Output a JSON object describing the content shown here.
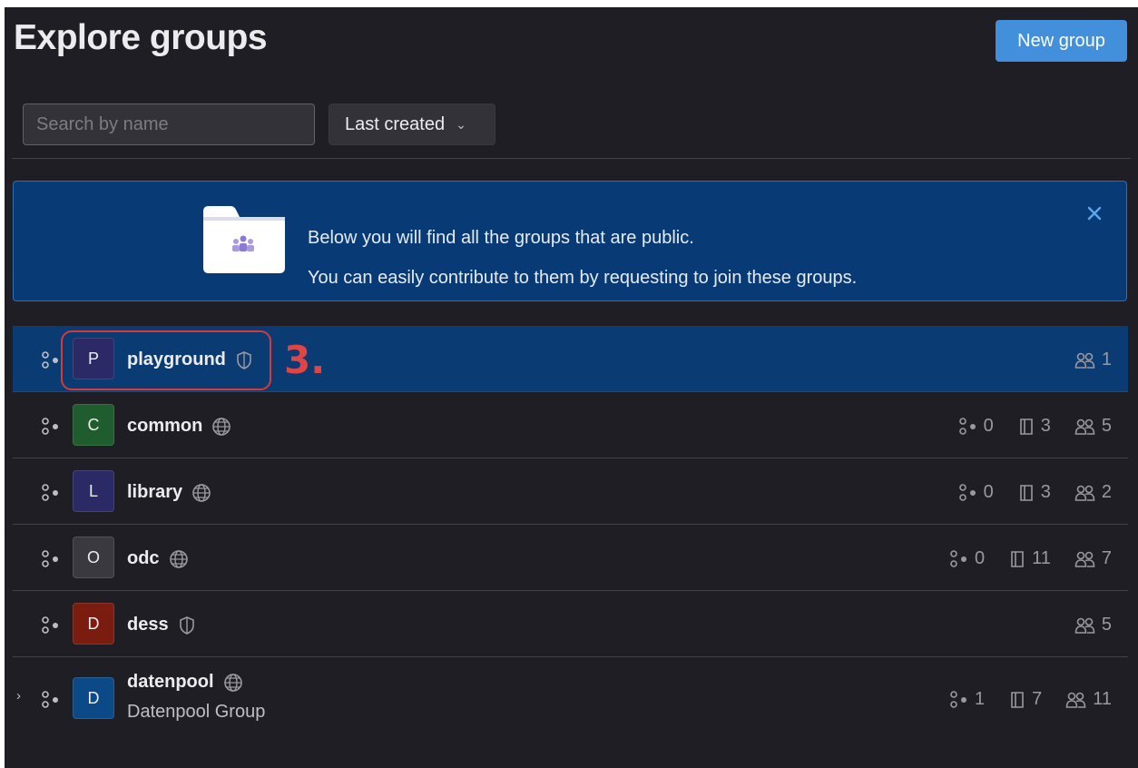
{
  "header": {
    "title": "Explore groups",
    "new_group_label": "New group"
  },
  "filters": {
    "search_placeholder": "Search by name",
    "sort_label": "Last created"
  },
  "banner": {
    "line1": "Below you will find all the groups that are public.",
    "line2": "You can easily contribute to them by requesting to join these groups."
  },
  "annotation": {
    "label": "3."
  },
  "groups": [
    {
      "letter": "P",
      "name": "playground",
      "visibility": "internal",
      "avatar_color": "#2c2a66",
      "subgroups": "",
      "projects": "",
      "members": "1"
    },
    {
      "letter": "C",
      "name": "common",
      "visibility": "public",
      "avatar_color": "#1f5c2e",
      "subgroups": "0",
      "projects": "3",
      "members": "5"
    },
    {
      "letter": "L",
      "name": "library",
      "visibility": "public",
      "avatar_color": "#2c2a66",
      "subgroups": "0",
      "projects": "3",
      "members": "2"
    },
    {
      "letter": "O",
      "name": "odc",
      "visibility": "public",
      "avatar_color": "#3a393f",
      "subgroups": "0",
      "projects": "11",
      "members": "7"
    },
    {
      "letter": "D",
      "name": "dess",
      "visibility": "internal",
      "avatar_color": "#7a1d10",
      "subgroups": "",
      "projects": "",
      "members": "5"
    },
    {
      "letter": "D",
      "name": "datenpool",
      "description": "Datenpool Group",
      "visibility": "public",
      "avatar_color": "#0b4a86",
      "subgroups": "1",
      "projects": "7",
      "members": "11"
    }
  ],
  "colors": {
    "background": "#1f1e24",
    "primary_button": "#428fdc",
    "banner": "#083b76",
    "highlight_row": "#0b3b73",
    "annotation": "#d63a3a"
  }
}
